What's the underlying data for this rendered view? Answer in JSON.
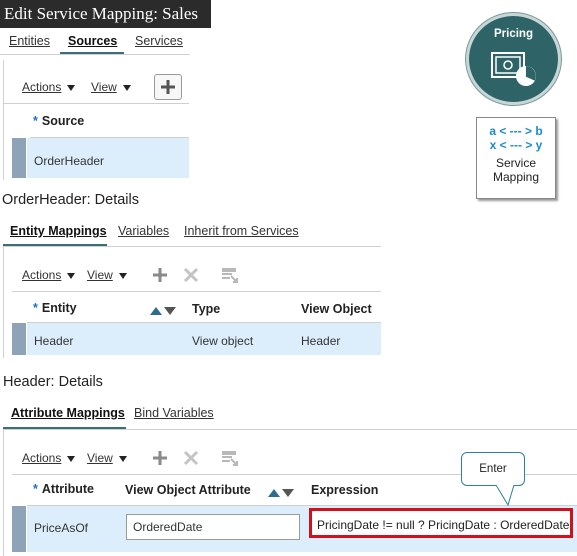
{
  "title": "Edit Service Mapping: Sales",
  "top_tabs": [
    "Entities",
    "Sources",
    "Services"
  ],
  "sources": {
    "actions": "Actions",
    "view": "View",
    "column": "Source",
    "row": "OrderHeader"
  },
  "pricing_badge": {
    "label": "Pricing"
  },
  "service_mapping_card": {
    "line1": "a < --- > b",
    "line2": "x < --- > y",
    "label1": "Service",
    "label2": "Mapping"
  },
  "orderheader_details": {
    "title": "OrderHeader: Details",
    "tabs": [
      "Entity Mappings",
      "Variables",
      "Inherit from Services"
    ],
    "actions": "Actions",
    "view": "View",
    "columns": [
      "Entity",
      "Type",
      "View Object"
    ],
    "row": {
      "entity": "Header",
      "type": "View object",
      "view_object": "Header"
    }
  },
  "header_details": {
    "title": "Header: Details",
    "tabs": [
      "Attribute Mappings",
      "Bind Variables"
    ],
    "actions": "Actions",
    "view": "View",
    "columns": [
      "Attribute",
      "View Object Attribute",
      "Expression"
    ],
    "row": {
      "attribute": "PriceAsOf",
      "view_object_attribute": "OrderedDate",
      "expression": "PricingDate != null ? PricingDate : OrderedDate"
    }
  },
  "callout": {
    "text": "Enter"
  },
  "colors": {
    "accent": "#3a6f7a",
    "selected_row": "#dceefb",
    "highlight": "#d0101a",
    "pricing_circle": "#2e6468"
  }
}
